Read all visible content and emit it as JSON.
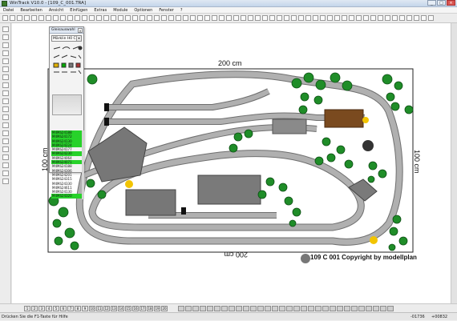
{
  "window": {
    "title": "WinTrack  V10.0 - [109_C_001.TRA]",
    "controls": [
      "_",
      "□",
      "×"
    ]
  },
  "menu": [
    "Datei",
    "Bearbeiten",
    "Ansicht",
    "Einfügen",
    "Extras",
    "Module",
    "Optionen",
    "Fenster",
    "?"
  ],
  "panel": {
    "title": "Gleisauswahl",
    "close_label": "×",
    "select_value": "Märklin H0 C-Gl",
    "select_arrow": "▾",
    "track_items": [
      "M4Mä24188",
      "M4Mä24172",
      "M4Mä24130",
      "M4Mä24224",
      "M4Mä24177",
      "M4Mä24230",
      "M4Mä24064",
      "M4Mä24071",
      "M4Mä24188",
      "M4Mä24306",
      "M4Mä24201",
      "M4Mä24315",
      "M4Mä24330",
      "M4Mä24611",
      "M4Mä24130",
      "M4Mä24320"
    ]
  },
  "layout": {
    "width_label_top": "200 cm",
    "width_label_bottom": "200 cm",
    "height_label_left": "100 cm",
    "height_label_right": "100 cm",
    "copyright": "109 C 001 Copyright by modellplan"
  },
  "page_tabs": [
    "1",
    "2",
    "3",
    "4",
    "5",
    "6",
    "7",
    "8",
    "9",
    "10",
    "11",
    "12",
    "13",
    "14",
    "15",
    "16",
    "17",
    "18",
    "19",
    "20"
  ],
  "status": {
    "hint": "Drücken Sie die  F1-Taste für Hilfe",
    "coord_x": "-01736",
    "coord_y": "+00832"
  },
  "colors": {
    "track": "#a9a9a9",
    "track_edge": "#6f6f6f",
    "tree": "#1f8d28",
    "building": "#777777",
    "station_roof": "#7a4a1f",
    "highlight": "#27d22a",
    "lamp": "#f2c400"
  }
}
